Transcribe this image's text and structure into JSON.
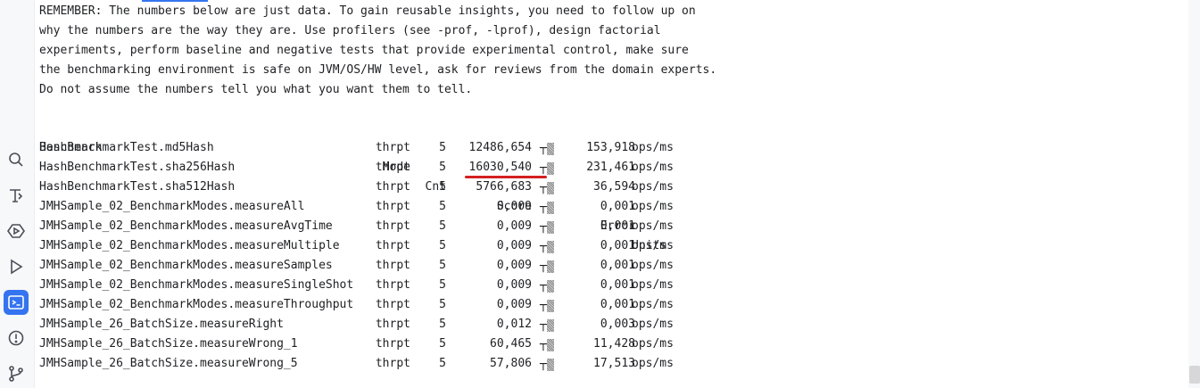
{
  "toolbar": {
    "icons": [
      "search-icon",
      "text-tool-icon",
      "services-icon",
      "run-icon",
      "terminal-icon",
      "problems-icon",
      "git-icon"
    ]
  },
  "console": {
    "remember_lines": [
      "REMEMBER: The numbers below are just data. To gain reusable insights, you need to follow up on",
      "why the numbers are the way they are. Use profilers (see -prof, -lprof), design factorial",
      "experiments, perform baseline and negative tests that provide experimental control, make sure",
      "the benchmarking environment is safe on JVM/OS/HW level, ask for reviews from the domain experts.",
      "Do not assume the numbers tell you what you want them to tell."
    ],
    "headers": {
      "benchmark": "Benchmark",
      "mode": "Mode",
      "cnt": "Cnt",
      "score": "Score",
      "error": "Error",
      "units": "Units"
    },
    "rows": [
      {
        "benchmark": "HashBenchmarkTest.md5Hash",
        "mode": "thrpt",
        "cnt": "5",
        "score": "12486,654",
        "error": "153,918",
        "units": "ops/ms"
      },
      {
        "benchmark": "HashBenchmarkTest.sha256Hash",
        "mode": "thrpt",
        "cnt": "5",
        "score": "16030,540",
        "error": "231,461",
        "units": "ops/ms"
      },
      {
        "benchmark": "HashBenchmarkTest.sha512Hash",
        "mode": "thrpt",
        "cnt": "5",
        "score": "5766,683",
        "error": "36,594",
        "units": "ops/ms"
      },
      {
        "benchmark": "JMHSample_02_BenchmarkModes.measureAll",
        "mode": "thrpt",
        "cnt": "5",
        "score": "0,009",
        "error": "0,001",
        "units": "ops/ms"
      },
      {
        "benchmark": "JMHSample_02_BenchmarkModes.measureAvgTime",
        "mode": "thrpt",
        "cnt": "5",
        "score": "0,009",
        "error": "0,001",
        "units": "ops/ms"
      },
      {
        "benchmark": "JMHSample_02_BenchmarkModes.measureMultiple",
        "mode": "thrpt",
        "cnt": "5",
        "score": "0,009",
        "error": "0,001",
        "units": "ops/ms"
      },
      {
        "benchmark": "JMHSample_02_BenchmarkModes.measureSamples",
        "mode": "thrpt",
        "cnt": "5",
        "score": "0,009",
        "error": "0,001",
        "units": "ops/ms"
      },
      {
        "benchmark": "JMHSample_02_BenchmarkModes.measureSingleShot",
        "mode": "thrpt",
        "cnt": "5",
        "score": "0,009",
        "error": "0,001",
        "units": "ops/ms"
      },
      {
        "benchmark": "JMHSample_02_BenchmarkModes.measureThroughput",
        "mode": "thrpt",
        "cnt": "5",
        "score": "0,009",
        "error": "0,001",
        "units": "ops/ms"
      },
      {
        "benchmark": "JMHSample_26_BatchSize.measureRight",
        "mode": "thrpt",
        "cnt": "5",
        "score": "0,012",
        "error": "0,003",
        "units": "ops/ms"
      },
      {
        "benchmark": "JMHSample_26_BatchSize.measureWrong_1",
        "mode": "thrpt",
        "cnt": "5",
        "score": "60,465",
        "error": "11,428",
        "units": "ops/ms"
      },
      {
        "benchmark": "JMHSample_26_BatchSize.measureWrong_5",
        "mode": "thrpt",
        "cnt": "5",
        "score": "57,806",
        "error": "17,513",
        "units": "ops/ms"
      }
    ],
    "highlight_color": "#d32020"
  }
}
